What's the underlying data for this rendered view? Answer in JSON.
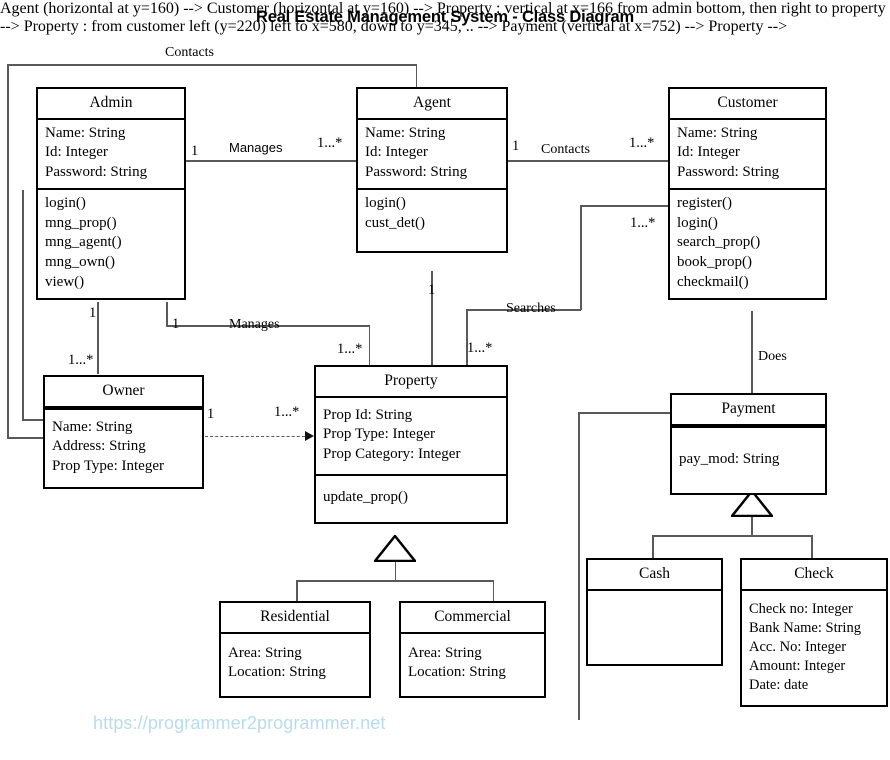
{
  "title": "Real Estate Management System - Class Diagram",
  "watermark": "https://programmer2programmer.net",
  "classes": {
    "admin": {
      "name": "Admin",
      "attributes": [
        "Name: String",
        "Id: Integer",
        "Password: String"
      ],
      "methods": [
        "login()",
        "mng_prop()",
        "mng_agent()",
        "mng_own()",
        "view()"
      ]
    },
    "agent": {
      "name": "Agent",
      "attributes": [
        "Name: String",
        "Id: Integer",
        "Password: String"
      ],
      "methods": [
        "login()",
        "cust_det()"
      ]
    },
    "customer": {
      "name": "Customer",
      "attributes": [
        "Name: String",
        "Id: Integer",
        "Password: String"
      ],
      "methods": [
        "register()",
        "login()",
        "search_prop()",
        "book_prop()",
        "checkmail()"
      ]
    },
    "owner": {
      "name": "Owner",
      "attributes": [
        "Name: String",
        "Address: String",
        "Prop Type: Integer"
      ],
      "methods": []
    },
    "property": {
      "name": "Property",
      "attributes": [
        "Prop Id: String",
        "Prop Type: Integer",
        "Prop Category: Integer"
      ],
      "methods": [
        "update_prop()"
      ]
    },
    "payment": {
      "name": "Payment",
      "attributes": [
        "pay_mod: String"
      ],
      "methods": []
    },
    "residential": {
      "name": "Residential",
      "attributes": [
        "Area: String",
        "Location: String"
      ],
      "methods": []
    },
    "commercial": {
      "name": "Commercial",
      "attributes": [
        "Area: String",
        "Location: String"
      ],
      "methods": []
    },
    "cash": {
      "name": "Cash",
      "attributes": [],
      "methods": []
    },
    "check": {
      "name": "Check",
      "attributes": [
        "Check no: Integer",
        "Bank Name: String",
        "Acc. No: Integer",
        "Amount: Integer",
        "Date: date"
      ],
      "methods": []
    }
  },
  "associations": {
    "contacts_top": "Contacts",
    "admin_manages_agent": "Manages",
    "agent_contacts_customer": "Contacts",
    "admin_manages_property": "Manages",
    "customer_searches_property": "Searches",
    "customer_does_payment": "Does"
  },
  "multiplicities": {
    "admin_to_agent_src": "1",
    "admin_to_agent_dst": "1...*",
    "agent_to_customer_src": "1",
    "agent_to_customer_dst": "1...*",
    "admin_to_owner_src": "1",
    "admin_to_owner_dst": "1...*",
    "admin_to_property_src": "1",
    "admin_to_property_dst": "1...*",
    "agent_to_property_src": "1",
    "customer_to_property_src": "1...*",
    "customer_to_property_dst": "1...*",
    "owner_to_property_src": "1",
    "owner_to_property_dst": "1...*"
  }
}
